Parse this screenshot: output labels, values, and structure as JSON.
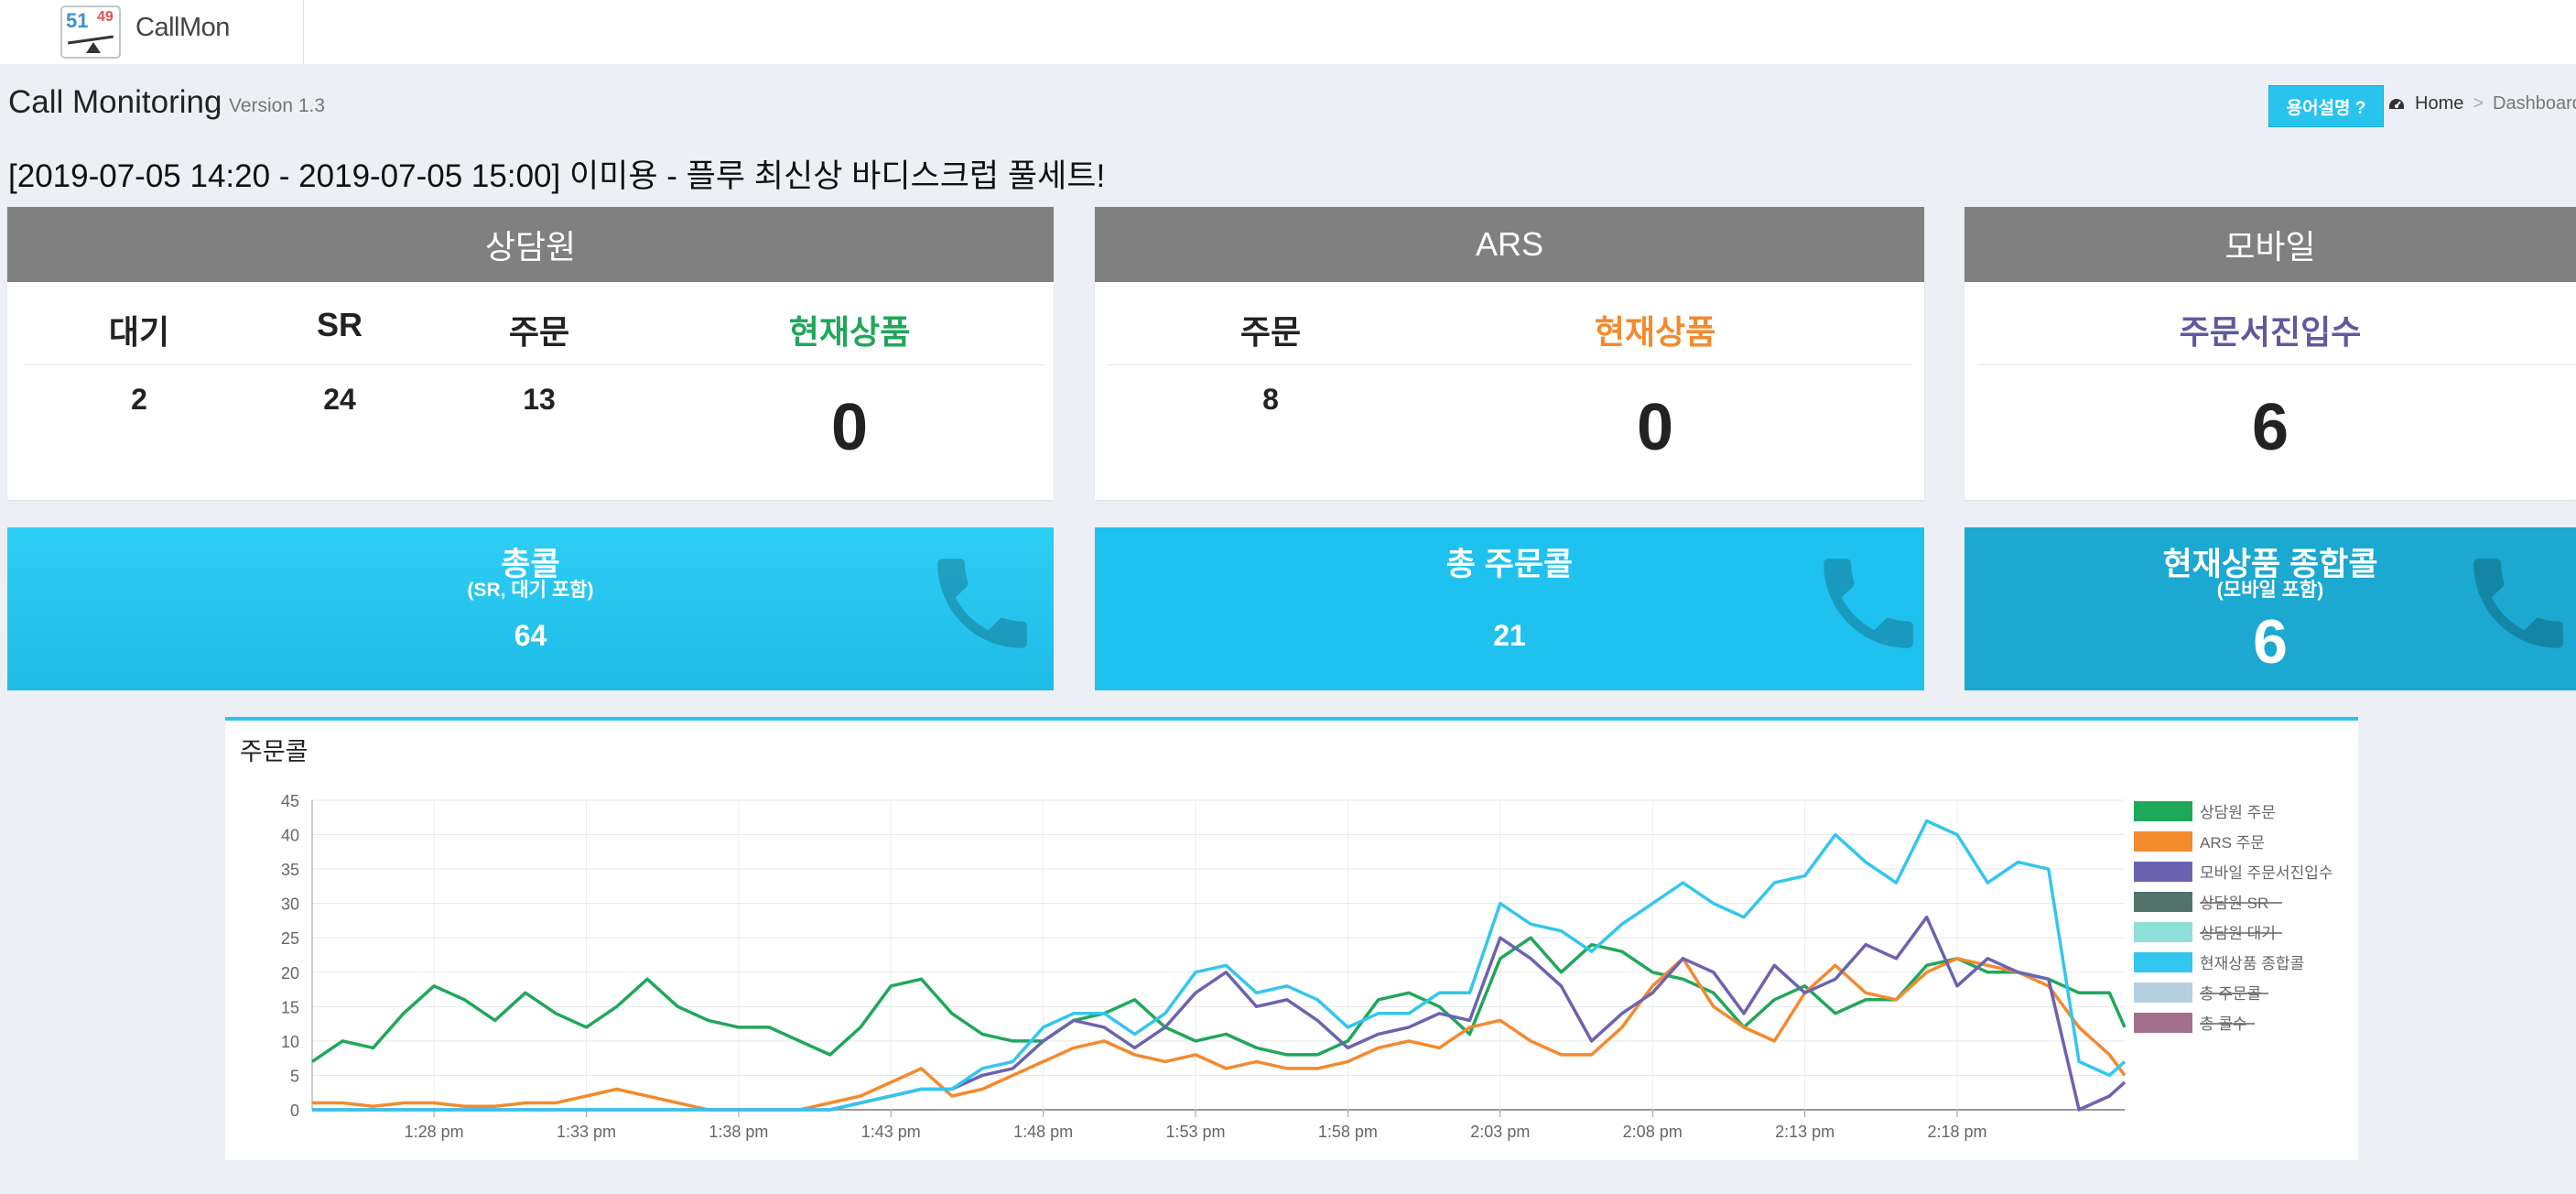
{
  "app": {
    "name": "CallMon",
    "logo_left": "51",
    "logo_right": "49"
  },
  "header": {
    "title": "Call Monitoring",
    "version": "Version 1.3",
    "help_button": "용어설명 ?"
  },
  "breadcrumb": {
    "home": "Home",
    "sep": ">",
    "current": "Dashboard"
  },
  "program": "[2019-07-05 14:20 - 2019-07-05 15:00] 이미용 - 플루 최신상 바디스크럽 풀세트!",
  "colors": {
    "teal_dark": "#1eb1d4",
    "teal": "#29c4ee",
    "green": "#1fa75a",
    "orange": "#f38a2e",
    "purple": "#6b63b0",
    "gray_header": "#808080"
  },
  "agent_box": {
    "title": "상담원",
    "labels": [
      "대기",
      "SR",
      "주문",
      "현재상품"
    ],
    "values": [
      "2",
      "24",
      "13",
      "0"
    ]
  },
  "ars_box": {
    "title": "ARS",
    "labels": [
      "주문",
      "현재상품"
    ],
    "values": [
      "8",
      "0"
    ]
  },
  "mobile_box": {
    "title": "모바일",
    "label": "주문서진입수",
    "value": "6"
  },
  "info_boxes": [
    {
      "title": "총콜",
      "sub": "(SR, 대기 포함)",
      "value": "64",
      "icon": "phone-icon"
    },
    {
      "title": "총 주문콜",
      "sub": "",
      "value": "21",
      "icon": "phone-icon"
    },
    {
      "title": "현재상품 종합콜",
      "sub": "(모바일 포함)",
      "value": "6",
      "icon": "phone-icon"
    }
  ],
  "chart_panel_title": "주문콜",
  "chart_data": {
    "type": "line",
    "title": "",
    "xlabel": "",
    "ylabel": "",
    "ylim": [
      0,
      45
    ],
    "yticks": [
      "0",
      "5",
      "10",
      "15",
      "20",
      "25",
      "30",
      "35",
      "40",
      "45"
    ],
    "xtick_labels": [
      "1:28 pm",
      "1:33 pm",
      "1:38 pm",
      "1:43 pm",
      "1:48 pm",
      "1:53 pm",
      "1:58 pm",
      "2:03 pm",
      "2:08 pm",
      "2:13 pm",
      "2:18 pm"
    ],
    "xtick_minutes": [
      88,
      93,
      98,
      103,
      108,
      113,
      118,
      123,
      128,
      133,
      138
    ],
    "x_range_minutes": [
      84,
      143.5
    ],
    "grid": true,
    "legend_position": "right",
    "x": [
      84,
      85,
      86,
      87,
      88,
      89,
      90,
      91,
      92,
      93,
      94,
      95,
      96,
      97,
      98,
      99,
      100,
      101,
      102,
      103,
      104,
      105,
      106,
      107,
      108,
      109,
      110,
      111,
      112,
      113,
      114,
      115,
      116,
      117,
      118,
      119,
      120,
      121,
      122,
      123,
      124,
      125,
      126,
      127,
      128,
      129,
      130,
      131,
      132,
      133,
      134,
      135,
      136,
      137,
      138,
      139,
      140,
      141,
      142,
      143,
      143.5
    ],
    "series": [
      {
        "name": "상담원 주문",
        "color": "#1fa75a",
        "hidden": false,
        "values": [
          7,
          10,
          9,
          14,
          18,
          16,
          13,
          17,
          14,
          12,
          15,
          19,
          15,
          13,
          12,
          12,
          10,
          8,
          12,
          18,
          19,
          14,
          11,
          10,
          10,
          13,
          14,
          16,
          12,
          10,
          11,
          9,
          8,
          8,
          10,
          16,
          17,
          15,
          11,
          22,
          25,
          20,
          24,
          23,
          20,
          19,
          17,
          12,
          16,
          18,
          14,
          16,
          16,
          21,
          22,
          20,
          20,
          19,
          17,
          17,
          12
        ]
      },
      {
        "name": "ARS 주문",
        "color": "#f38a2e",
        "hidden": false,
        "values": [
          1,
          1,
          0.5,
          1,
          1,
          0.5,
          0.5,
          1,
          1,
          2,
          3,
          2,
          1,
          0,
          0,
          0,
          0,
          1,
          2,
          4,
          6,
          2,
          3,
          5,
          7,
          9,
          10,
          8,
          7,
          8,
          6,
          7,
          6,
          6,
          7,
          9,
          10,
          9,
          12,
          13,
          10,
          8,
          8,
          12,
          18,
          22,
          15,
          12,
          10,
          17,
          21,
          17,
          16,
          20,
          22,
          21,
          20,
          18,
          12,
          8,
          5
        ]
      },
      {
        "name": "모바일 주문서진입수",
        "color": "#6b63b0",
        "hidden": false,
        "values": [
          0,
          0,
          0,
          0,
          0,
          0,
          0,
          0,
          0,
          0,
          0,
          0,
          0,
          0,
          0,
          0,
          0,
          0,
          1,
          2,
          3,
          3,
          5,
          6,
          10,
          13,
          12,
          9,
          12,
          17,
          20,
          15,
          16,
          13,
          9,
          11,
          12,
          14,
          13,
          25,
          22,
          18,
          10,
          14,
          17,
          22,
          20,
          14,
          21,
          17,
          19,
          24,
          22,
          28,
          18,
          22,
          20,
          19,
          0,
          2,
          4
        ]
      },
      {
        "name": "상담원 SR",
        "color": "#53736a",
        "hidden": true,
        "values": []
      },
      {
        "name": "상담원 대기",
        "color": "#8fe0d6",
        "hidden": true,
        "values": []
      },
      {
        "name": "현재상품 종합콜",
        "color": "#33c6ee",
        "hidden": false,
        "values": [
          0,
          0,
          0,
          0,
          0,
          0,
          0,
          0,
          0,
          0,
          0,
          0,
          0,
          0,
          0,
          0,
          0,
          0,
          1,
          2,
          3,
          3,
          6,
          7,
          12,
          14,
          14,
          11,
          14,
          20,
          21,
          17,
          18,
          16,
          12,
          14,
          14,
          17,
          17,
          30,
          27,
          26,
          23,
          27,
          30,
          33,
          30,
          28,
          33,
          34,
          40,
          36,
          33,
          42,
          40,
          33,
          36,
          35,
          7,
          5,
          7
        ]
      },
      {
        "name": "총 주문콜",
        "color": "#b5cfe0",
        "hidden": true,
        "values": []
      },
      {
        "name": "총 콜수",
        "color": "#a3708c",
        "hidden": true,
        "values": []
      }
    ]
  }
}
